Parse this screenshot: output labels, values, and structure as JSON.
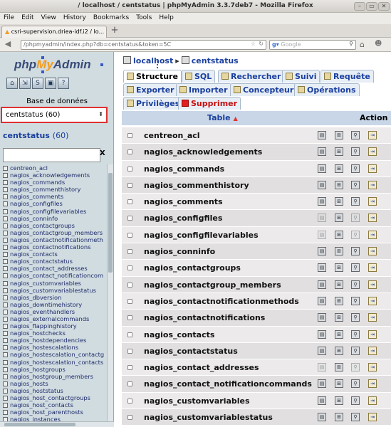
{
  "window": {
    "title": "/ localhost / centstatus | phpMyAdmin 3.3.7deb7 - Mozilla Firefox",
    "controls": [
      "–",
      "▭",
      "✕"
    ]
  },
  "menu": [
    "File",
    "Edit",
    "View",
    "History",
    "Bookmarks",
    "Tools",
    "Help"
  ],
  "browser_tab": {
    "label": "csri-supervision.driea-idf.i2 / lo...",
    "new_tab": "+"
  },
  "nav": {
    "url": "/phpmyadmin/index.php?db=centstatus&token=5C",
    "search_engine": "Google",
    "search_placeholder": "Google"
  },
  "sidebar": {
    "logo_php": "php",
    "logo_my": "My",
    "logo_admin": "Admin",
    "icons": [
      "home-icon",
      "exit-icon",
      "sql-icon",
      "query-window-icon",
      "docs-icon"
    ],
    "database_label": "Base de données",
    "database_selected": "centstatus (60)",
    "db_name": "centstatus",
    "db_count": "(60)",
    "filter_clear": "X",
    "tables": [
      "centreon_acl",
      "nagios_acknowledgements",
      "nagios_commands",
      "nagios_commenthistory",
      "nagios_comments",
      "nagios_configfiles",
      "nagios_configfilevariables",
      "nagios_conninfo",
      "nagios_contactgroups",
      "nagios_contactgroup_members",
      "nagios_contactnotificationmeth",
      "nagios_contactnotifications",
      "nagios_contacts",
      "nagios_contactstatus",
      "nagios_contact_addresses",
      "nagios_contact_notificationcom",
      "nagios_customvariables",
      "nagios_customvariablestatus",
      "nagios_dbversion",
      "nagios_downtimehistory",
      "nagios_eventhandlers",
      "nagios_externalcommands",
      "nagios_flappinghistory",
      "nagios_hostchecks",
      "nagios_hostdependencies",
      "nagios_hostescalations",
      "nagios_hostescalation_contactg",
      "nagios_hostescalation_contacts",
      "nagios_hostgroups",
      "nagios_hostgroup_members",
      "nagios_hosts",
      "nagios_hoststatus",
      "nagios_host_contactgroups",
      "nagios_host_contacts",
      "nagios_host_parenthosts",
      "nagios_instances"
    ]
  },
  "breadcrumb": {
    "server": "localhost",
    "sep": "▸",
    "db": "centstatus"
  },
  "tabs": {
    "row1": [
      "Structure",
      "SQL",
      "Rechercher",
      "Suivi",
      "Requête"
    ],
    "row2": [
      "Exporter",
      "Importer",
      "Concepteur",
      "Opérations"
    ],
    "row3": [
      "Privilèges",
      "Supprimer"
    ]
  },
  "table": {
    "header_table": "Table",
    "sort_indicator": "▲",
    "header_action": "Action",
    "rows": [
      {
        "name": "centreon_acl",
        "empty": false
      },
      {
        "name": "nagios_acknowledgements",
        "empty": false
      },
      {
        "name": "nagios_commands",
        "empty": false
      },
      {
        "name": "nagios_commenthistory",
        "empty": false
      },
      {
        "name": "nagios_comments",
        "empty": false
      },
      {
        "name": "nagios_configfiles",
        "empty": true
      },
      {
        "name": "nagios_configfilevariables",
        "empty": true
      },
      {
        "name": "nagios_conninfo",
        "empty": false
      },
      {
        "name": "nagios_contactgroups",
        "empty": false
      },
      {
        "name": "nagios_contactgroup_members",
        "empty": false
      },
      {
        "name": "nagios_contactnotificationmethods",
        "empty": false
      },
      {
        "name": "nagios_contactnotifications",
        "empty": false
      },
      {
        "name": "nagios_contacts",
        "empty": false
      },
      {
        "name": "nagios_contactstatus",
        "empty": false
      },
      {
        "name": "nagios_contact_addresses",
        "empty": true
      },
      {
        "name": "nagios_contact_notificationcommands",
        "empty": false
      },
      {
        "name": "nagios_customvariables",
        "empty": false
      },
      {
        "name": "nagios_customvariablestatus",
        "empty": false
      }
    ]
  },
  "colors": {
    "link": "#1a3f9e",
    "sidebar_bg": "#d0dce0",
    "highlight_border": "#e03030",
    "header_bg": "#c8d6e8"
  }
}
